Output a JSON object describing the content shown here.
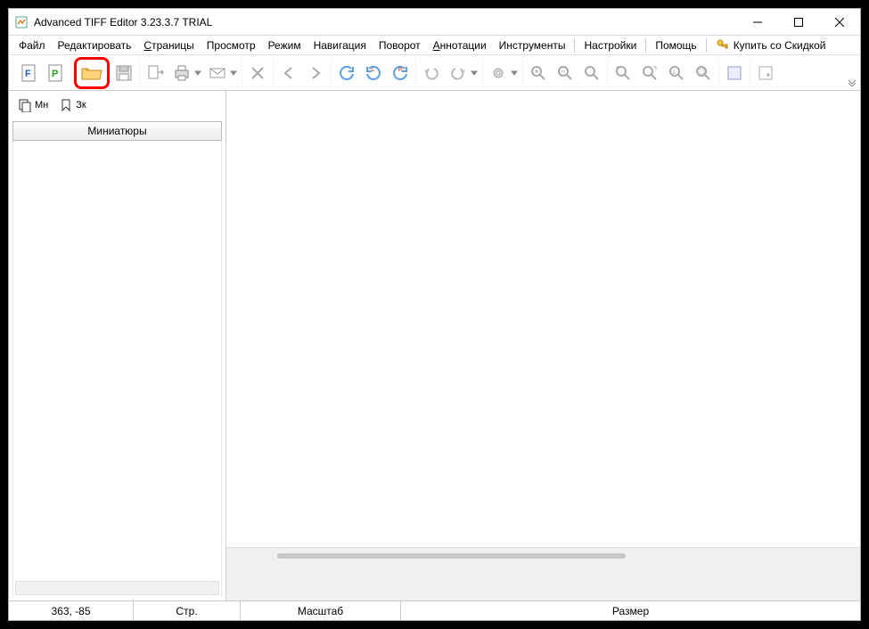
{
  "window": {
    "title": "Advanced TIFF Editor 3.23.3.7 TRIAL"
  },
  "menu": {
    "file": "Файл",
    "edit": "Редактировать",
    "pages": "Страницы",
    "view": "Просмотр",
    "mode": "Режим",
    "navigation": "Навигация",
    "rotate": "Поворот",
    "annotations": "Аннотации",
    "tools": "Инструменты",
    "settings": "Настройки",
    "help": "Помощь",
    "buy": "Купить со Скидкой"
  },
  "toolbar": {
    "icons": {
      "file_f": "F",
      "file_p": "P"
    }
  },
  "sidebar": {
    "tab_thumbs": "Мн",
    "tab_bookmarks": "Зк",
    "thumbnails_header": "Миниатюры"
  },
  "status": {
    "coords": "363, -85",
    "page_label": "Стр.",
    "zoom_label": "Масштаб",
    "size_label": "Размер"
  }
}
